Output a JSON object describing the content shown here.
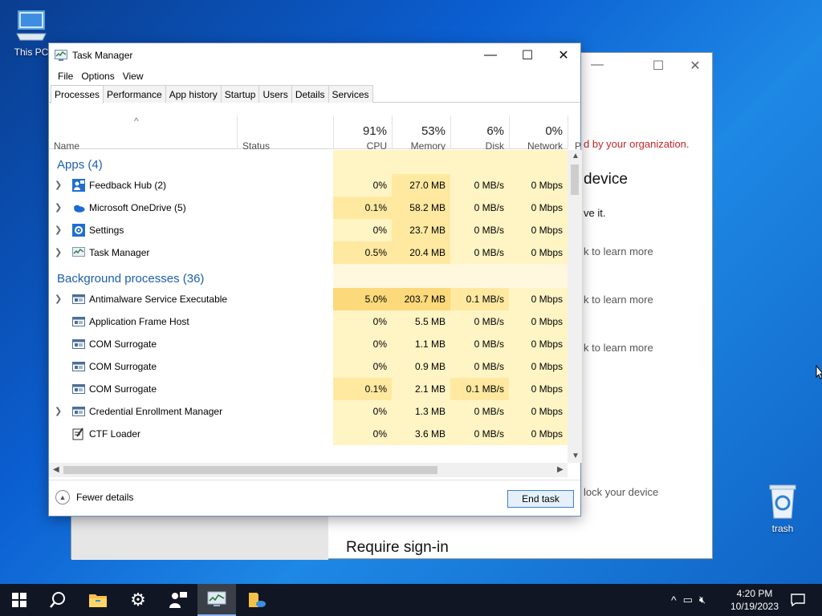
{
  "desktop": {
    "this_pc_label": "This PC",
    "trash_label": "trash"
  },
  "background_window": {
    "red_text": "d by your organization.",
    "heading_text": "device",
    "line1": "ve it.",
    "learn1": "k to learn more",
    "learn2": "k to learn more",
    "learn3": "k to learn more",
    "lock_text": "lock your device",
    "require_signin": "Require sign-in"
  },
  "task_manager": {
    "title": "Task Manager",
    "menu": [
      "File",
      "Options",
      "View"
    ],
    "tabs": [
      "Processes",
      "Performance",
      "App history",
      "Startup",
      "Users",
      "Details",
      "Services"
    ],
    "active_tab": "Processes",
    "columns": {
      "name": "Name",
      "status": "Status",
      "cpu_pct": "91%",
      "cpu": "CPU",
      "memory_pct": "53%",
      "memory": "Memory",
      "disk_pct": "6%",
      "disk": "Disk",
      "network_pct": "0%",
      "network": "Network",
      "power_partial": "P"
    },
    "groups": {
      "apps": "Apps (4)",
      "background": "Background processes (36)"
    },
    "apps": [
      {
        "name": "Feedback Hub (2)",
        "cpu": "0%",
        "memory": "27.0 MB",
        "disk": "0 MB/s",
        "network": "0 Mbps",
        "icon": "feedback-hub-icon",
        "expandable": true
      },
      {
        "name": "Microsoft OneDrive (5)",
        "cpu": "0.1%",
        "memory": "58.2 MB",
        "disk": "0 MB/s",
        "network": "0 Mbps",
        "icon": "onedrive-icon",
        "expandable": true
      },
      {
        "name": "Settings",
        "cpu": "0%",
        "memory": "23.7 MB",
        "disk": "0 MB/s",
        "network": "0 Mbps",
        "icon": "settings-gear-icon",
        "expandable": true
      },
      {
        "name": "Task Manager",
        "cpu": "0.5%",
        "memory": "20.4 MB",
        "disk": "0 MB/s",
        "network": "0 Mbps",
        "icon": "task-manager-icon",
        "expandable": true
      }
    ],
    "background": [
      {
        "name": "Antimalware Service Executable",
        "cpu": "5.0%",
        "memory": "203.7 MB",
        "disk": "0.1 MB/s",
        "network": "0 Mbps",
        "icon": "process-window-icon",
        "expandable": true
      },
      {
        "name": "Application Frame Host",
        "cpu": "0%",
        "memory": "5.5 MB",
        "disk": "0 MB/s",
        "network": "0 Mbps",
        "icon": "process-window-icon",
        "expandable": false
      },
      {
        "name": "COM Surrogate",
        "cpu": "0%",
        "memory": "1.1 MB",
        "disk": "0 MB/s",
        "network": "0 Mbps",
        "icon": "process-window-icon",
        "expandable": false
      },
      {
        "name": "COM Surrogate",
        "cpu": "0%",
        "memory": "0.9 MB",
        "disk": "0 MB/s",
        "network": "0 Mbps",
        "icon": "process-window-icon",
        "expandable": false
      },
      {
        "name": "COM Surrogate",
        "cpu": "0.1%",
        "memory": "2.1 MB",
        "disk": "0.1 MB/s",
        "network": "0 Mbps",
        "icon": "process-window-icon",
        "expandable": false
      },
      {
        "name": "Credential Enrollment Manager",
        "cpu": "0%",
        "memory": "1.3 MB",
        "disk": "0 MB/s",
        "network": "0 Mbps",
        "icon": "process-window-icon",
        "expandable": true
      },
      {
        "name": "CTF Loader",
        "cpu": "0%",
        "memory": "3.6 MB",
        "disk": "0 MB/s",
        "network": "0 Mbps",
        "icon": "ctf-loader-icon",
        "expandable": false
      }
    ],
    "footer": {
      "fewer_details": "Fewer details",
      "end_task": "End task"
    }
  },
  "taskbar": {
    "time": "4:20 PM",
    "date": "10/19/2023"
  },
  "colors": {
    "group_blue": "#1c5faa",
    "heat_light": "#fff4c4",
    "heat_mid": "#ffe9a0",
    "heat_strong": "#fcd97a"
  }
}
